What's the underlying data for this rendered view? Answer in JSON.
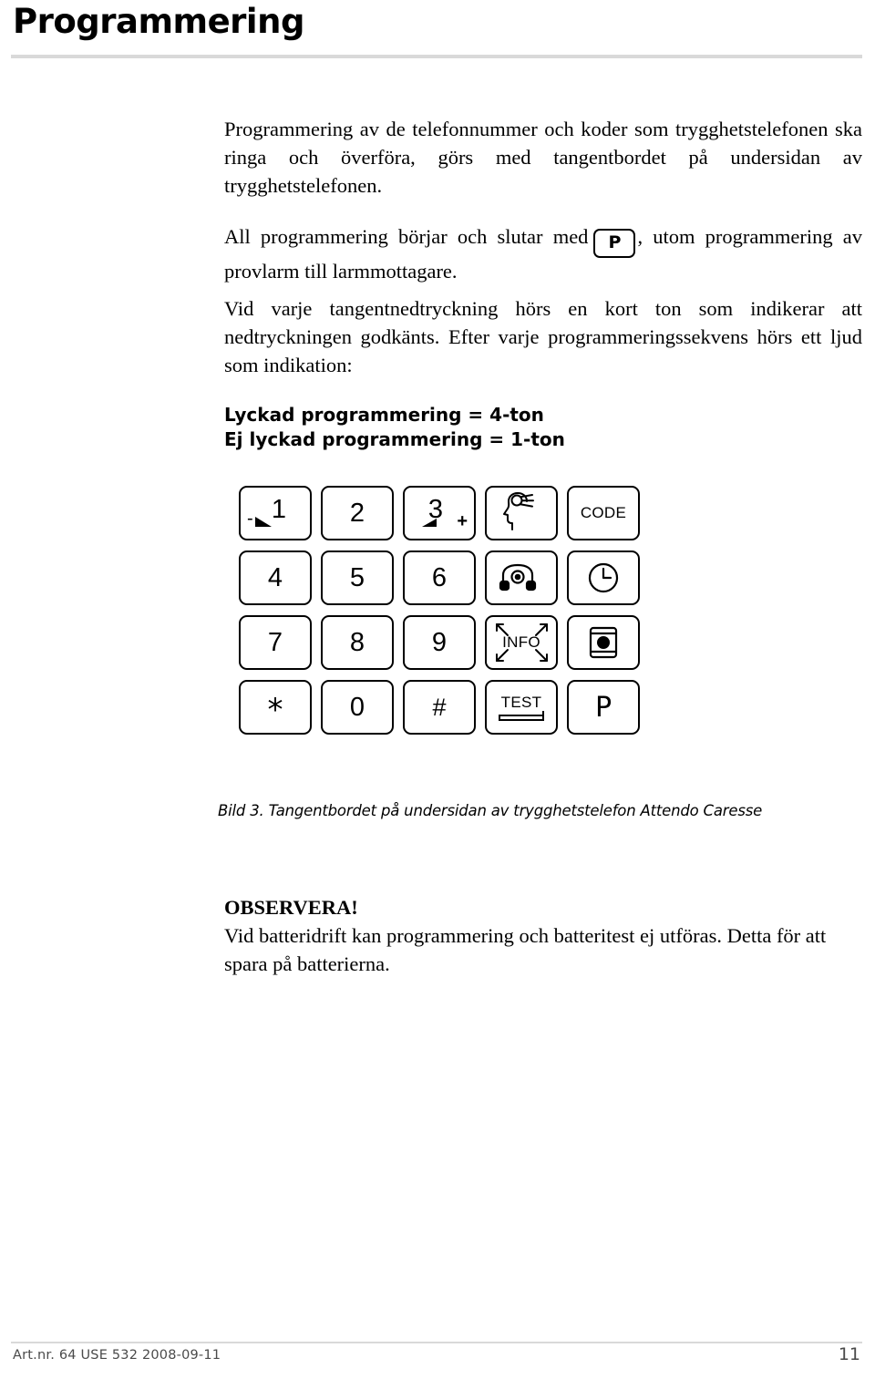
{
  "header": {
    "title": "Programmering"
  },
  "body": {
    "paragraph1": "Programmering av de telefonnummer och koder som trygghetstelefonen ska ringa och överföra, görs med tangentbordet på undersidan av trygghetstelefonen.",
    "paragraph2_part1": "All programmering börjar och slutar med",
    "paragraph2_key": "P",
    "paragraph2_part2": ", utom programmering av provlarm till larmmottagare.",
    "paragraph3": "Vid varje tangentnedtryckning hörs en kort ton som indikerar att nedtryckningen godkänts. Efter varje programmeringssekvens hörs ett ljud som indikation:",
    "bold_line1": "Lyckad programmering = 4-ton",
    "bold_line2": "Ej lyckad programmering = 1-ton"
  },
  "keypad": {
    "rows": [
      [
        {
          "label": "1",
          "type": "digit-minus"
        },
        {
          "label": "2",
          "type": "digit"
        },
        {
          "label": "3",
          "type": "digit-plus"
        },
        {
          "label": "",
          "type": "speech-icon"
        },
        {
          "label": "CODE",
          "type": "text"
        }
      ],
      [
        {
          "label": "4",
          "type": "digit"
        },
        {
          "label": "5",
          "type": "digit"
        },
        {
          "label": "6",
          "type": "digit"
        },
        {
          "label": "",
          "type": "phone-icon"
        },
        {
          "label": "",
          "type": "clock-icon"
        }
      ],
      [
        {
          "label": "7",
          "type": "digit"
        },
        {
          "label": "8",
          "type": "digit"
        },
        {
          "label": "9",
          "type": "digit"
        },
        {
          "label": "INFO",
          "type": "info"
        },
        {
          "label": "",
          "type": "button-icon"
        }
      ],
      [
        {
          "label": "*",
          "type": "star"
        },
        {
          "label": "0",
          "type": "digit"
        },
        {
          "label": "#",
          "type": "hash"
        },
        {
          "label": "TEST",
          "type": "test"
        },
        {
          "label": "P",
          "type": "p-key"
        }
      ]
    ]
  },
  "caption": {
    "text": "Bild 3. Tangentbordet på undersidan av trygghetstelefon Attendo Caresse"
  },
  "note": {
    "title": "OBSERVERA!",
    "text": "Vid batteridrift kan programmering och batteritest ej utföras. Detta för att spara på batterierna."
  },
  "footer": {
    "left": "Art.nr. 64 USE 532  2008-09-11",
    "page_number": "11"
  }
}
